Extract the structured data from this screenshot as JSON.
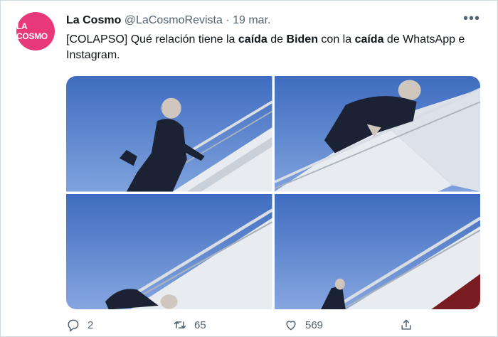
{
  "author": {
    "avatar_text": "LA COSMO",
    "name": "La Cosmo",
    "handle": "@LaCosmoRevista",
    "separator": "·",
    "date": "19 mar."
  },
  "more_label": "•••",
  "tweet_text": {
    "part1": "[COLAPSO] Qué relación tiene la ",
    "bold1": "caída",
    "part2": " de ",
    "bold2": "Biden",
    "part3": " con la ",
    "bold3": "caída",
    "part4": " de WhatsApp e Instagram."
  },
  "actions": {
    "replies": "2",
    "retweets": "65",
    "likes": "569"
  },
  "colors": {
    "brand": "#e8387a",
    "sky": "#4d79c7",
    "muted": "#536471"
  },
  "icons": [
    "reply-icon",
    "retweet-icon",
    "like-icon",
    "share-icon"
  ]
}
